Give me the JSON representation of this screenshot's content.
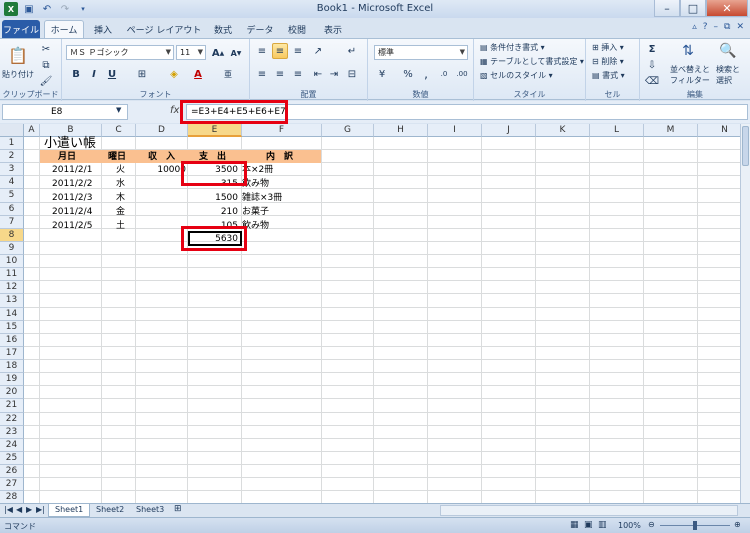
{
  "window": {
    "title": "Book1 - Microsoft Excel"
  },
  "tabs": [
    "ファイル",
    "ホーム",
    "挿入",
    "ページ レイアウト",
    "数式",
    "データ",
    "校閲",
    "表示"
  ],
  "ribbon": {
    "clipboard": {
      "label": "クリップボード",
      "paste": "貼り付け"
    },
    "font": {
      "label": "フォント",
      "name": "ＭＳ Ｐゴシック",
      "size": "11"
    },
    "alignment": {
      "label": "配置"
    },
    "number": {
      "label": "数値",
      "format": "標準"
    },
    "styles": {
      "label": "スタイル",
      "conditional": "条件付き書式",
      "table": "テーブルとして書式設定",
      "cell": "セルのスタイル"
    },
    "cells": {
      "label": "セル",
      "insert": "挿入",
      "delete": "削除",
      "format": "書式"
    },
    "editing": {
      "label": "編集",
      "sort": "並べ替えと",
      "sort2": "フィルター",
      "find": "検索と",
      "find2": "選択"
    }
  },
  "formula_bar": {
    "name_box": "E8",
    "fx": "fx",
    "formula": "=E3+E4+E5+E6+E7"
  },
  "columns": [
    "A",
    "B",
    "C",
    "D",
    "E",
    "F",
    "G",
    "H",
    "I",
    "J",
    "K",
    "L",
    "M",
    "N"
  ],
  "rows": [
    "1",
    "2",
    "3",
    "4",
    "5",
    "6",
    "7",
    "8",
    "9",
    "10",
    "11",
    "12",
    "13",
    "14",
    "15",
    "16",
    "17",
    "18",
    "19",
    "20",
    "21",
    "22",
    "23",
    "24",
    "25",
    "26",
    "27",
    "28"
  ],
  "sheet": {
    "title": "小遣い帳",
    "headers": {
      "date": "月日",
      "weekday": "曜日",
      "income": "収　入",
      "expense": "支　出",
      "detail": "内　訳"
    },
    "rows": [
      {
        "date": "2011/2/1",
        "weekday": "火",
        "income": "10000",
        "expense": "3500",
        "detail": "本×2冊"
      },
      {
        "date": "2011/2/2",
        "weekday": "水",
        "income": "",
        "expense": "315",
        "detail": "飲み物"
      },
      {
        "date": "2011/2/3",
        "weekday": "木",
        "income": "",
        "expense": "1500",
        "detail": "雑誌×3冊"
      },
      {
        "date": "2011/2/4",
        "weekday": "金",
        "income": "",
        "expense": "210",
        "detail": "お菓子"
      },
      {
        "date": "2011/2/5",
        "weekday": "土",
        "income": "",
        "expense": "105",
        "detail": "飲み物"
      }
    ],
    "total": "5630"
  },
  "sheet_tabs": [
    "Sheet1",
    "Sheet2",
    "Sheet3"
  ],
  "status": {
    "mode": "コマンド",
    "zoom": "100%"
  },
  "colors": {
    "header_fill": "#fac090",
    "highlight": "#e60012",
    "file_tab": "#2a5ca8"
  }
}
